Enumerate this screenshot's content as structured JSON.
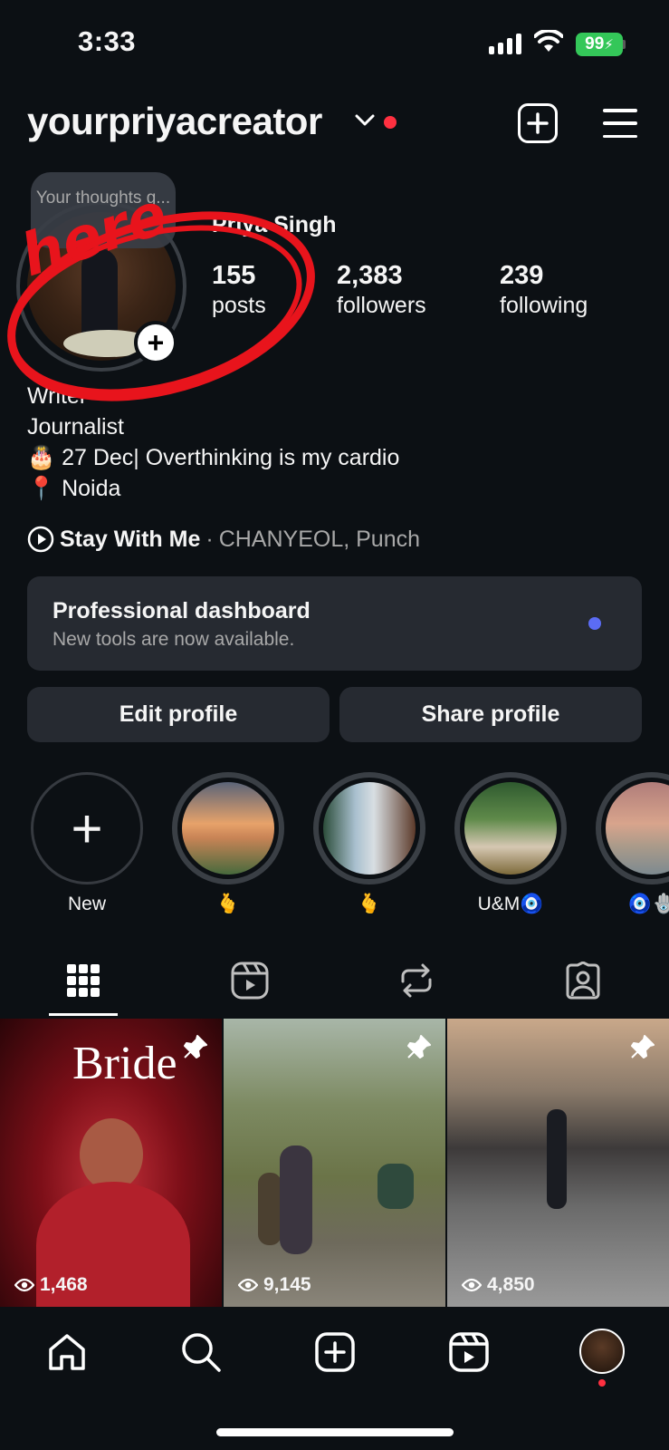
{
  "status_bar": {
    "time": "3:33",
    "battery": "99"
  },
  "header": {
    "username": "yourpriyacreator"
  },
  "profile": {
    "note": "Your thoughts g...",
    "display_name": "Priya Singh",
    "stats": [
      {
        "value": "155",
        "label": "posts"
      },
      {
        "value": "2,383",
        "label": "followers"
      },
      {
        "value": "239",
        "label": "following"
      }
    ],
    "bio_lines": [
      "Writer",
      "Journalist",
      "🎂 27 Dec| Overthinking is my cardio",
      "📍 Noida"
    ],
    "music": {
      "title": "Stay With Me",
      "separator": "·",
      "artist": "CHANYEOL, Punch"
    }
  },
  "annotation": {
    "text": "here",
    "color": "#e8141c"
  },
  "dashboard": {
    "title": "Professional dashboard",
    "subtitle": "New tools are now available."
  },
  "buttons": {
    "edit": "Edit profile",
    "share": "Share profile"
  },
  "highlights": [
    {
      "label": "New"
    },
    {
      "label": "🫰"
    },
    {
      "label": "🫰"
    },
    {
      "label": "U&M🧿"
    },
    {
      "label": "🧿🪬"
    }
  ],
  "posts": [
    {
      "caption": "Bride",
      "views": "1,468",
      "pinned": true
    },
    {
      "views": "9,145",
      "pinned": true
    },
    {
      "views": "4,850",
      "pinned": true
    }
  ]
}
